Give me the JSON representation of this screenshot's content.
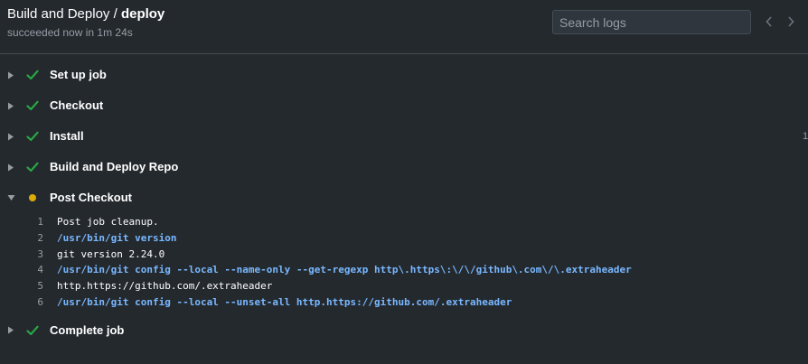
{
  "header": {
    "workflow": "Build and Deploy",
    "separator": " / ",
    "job": "deploy",
    "status_text": "succeeded now in 1m 24s",
    "search_placeholder": "Search logs"
  },
  "icons": {
    "prev": "chevron-left-icon",
    "next": "chevron-right-icon",
    "collapsed": "triangle-right-icon",
    "expanded": "triangle-down-icon",
    "success": "check-icon",
    "in_progress": "dot-icon"
  },
  "colors": {
    "background": "#24292e",
    "success": "#28a745",
    "in_progress": "#dbab09",
    "command": "#79b8ff",
    "muted": "#959da5"
  },
  "steps": [
    {
      "label": "Set up job",
      "status": "success",
      "expanded": false,
      "duration": ""
    },
    {
      "label": "Checkout",
      "status": "success",
      "expanded": false,
      "duration": ""
    },
    {
      "label": "Install",
      "status": "success",
      "expanded": false,
      "duration": "1"
    },
    {
      "label": "Build and Deploy Repo",
      "status": "success",
      "expanded": false,
      "duration": ""
    },
    {
      "label": "Post Checkout",
      "status": "in_progress",
      "expanded": true,
      "duration": "",
      "log": [
        {
          "n": "1",
          "text": "Post job cleanup.",
          "cmd": false
        },
        {
          "n": "2",
          "text": "/usr/bin/git version",
          "cmd": true
        },
        {
          "n": "3",
          "text": "git version 2.24.0",
          "cmd": false
        },
        {
          "n": "4",
          "text": "/usr/bin/git config --local --name-only --get-regexp http\\.https\\:\\/\\/github\\.com\\/\\.extraheader",
          "cmd": true
        },
        {
          "n": "5",
          "text": "http.https://github.com/.extraheader",
          "cmd": false
        },
        {
          "n": "6",
          "text": "/usr/bin/git config --local --unset-all http.https://github.com/.extraheader",
          "cmd": true
        }
      ]
    },
    {
      "label": "Complete job",
      "status": "success",
      "expanded": false,
      "duration": ""
    }
  ]
}
